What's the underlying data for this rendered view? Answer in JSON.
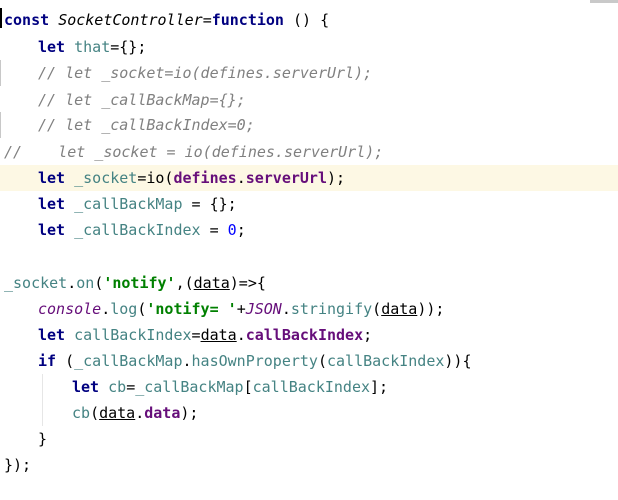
{
  "editor": {
    "lines": [
      {
        "tokens": [
          [
            "kw",
            "const "
          ],
          [
            "cls",
            "SocketController"
          ],
          [
            "plain",
            "="
          ],
          [
            "kw",
            "function"
          ],
          [
            "plain",
            " () {"
          ]
        ]
      },
      {
        "tokens": [
          [
            "kw",
            "let "
          ],
          [
            "var",
            "that"
          ],
          [
            "plain",
            "={};"
          ]
        ]
      },
      {
        "tokens": [
          [
            "cm",
            "// let _socket=io(defines.serverUrl);"
          ]
        ]
      },
      {
        "tokens": [
          [
            "cm",
            "// let _callBackMap={};"
          ]
        ]
      },
      {
        "tokens": [
          [
            "cm",
            "// let _callBackIndex=0;"
          ]
        ]
      },
      {
        "tokens": [
          [
            "cm",
            "//    let _socket = io(defines.serverUrl);"
          ]
        ]
      },
      {
        "tokens": [
          [
            "kw",
            "let "
          ],
          [
            "var",
            "_socket"
          ],
          [
            "plain",
            "="
          ],
          [
            "plain",
            "io("
          ],
          [
            "prop",
            "defines"
          ],
          [
            "plain",
            "."
          ],
          [
            "prop",
            "serverUrl"
          ],
          [
            "plain",
            ");"
          ]
        ]
      },
      {
        "tokens": [
          [
            "kw",
            "let "
          ],
          [
            "var",
            "_callBackMap"
          ],
          [
            "plain",
            " = {};"
          ]
        ]
      },
      {
        "tokens": [
          [
            "kw",
            "let "
          ],
          [
            "var",
            "_callBackIndex"
          ],
          [
            "plain",
            " = "
          ],
          [
            "num",
            "0"
          ],
          [
            "plain",
            ";"
          ]
        ]
      },
      {
        "tokens": []
      },
      {
        "tokens": [
          [
            "var",
            "_socket"
          ],
          [
            "plain",
            "."
          ],
          [
            "fn",
            "on"
          ],
          [
            "plain",
            "("
          ],
          [
            "str",
            "'notify'"
          ],
          [
            "plain",
            ",("
          ],
          [
            "param",
            "data"
          ],
          [
            "plain",
            ")=>{"
          ]
        ]
      },
      {
        "tokens": [
          [
            "gl",
            "console"
          ],
          [
            "plain",
            "."
          ],
          [
            "fn",
            "log"
          ],
          [
            "plain",
            "("
          ],
          [
            "str",
            "'notify= '"
          ],
          [
            "plain",
            "+"
          ],
          [
            "gl",
            "JSON"
          ],
          [
            "plain",
            "."
          ],
          [
            "fn",
            "stringify"
          ],
          [
            "plain",
            "("
          ],
          [
            "param",
            "data"
          ],
          [
            "plain",
            "));"
          ]
        ]
      },
      {
        "tokens": [
          [
            "kw",
            "let "
          ],
          [
            "var",
            "callBackIndex"
          ],
          [
            "plain",
            "="
          ],
          [
            "param",
            "data"
          ],
          [
            "plain",
            "."
          ],
          [
            "prop",
            "callBackIndex"
          ],
          [
            "plain",
            ";"
          ]
        ]
      },
      {
        "tokens": [
          [
            "kw",
            "if "
          ],
          [
            "plain",
            "("
          ],
          [
            "var",
            "_callBackMap"
          ],
          [
            "plain",
            "."
          ],
          [
            "fn",
            "hasOwnProperty"
          ],
          [
            "plain",
            "("
          ],
          [
            "var",
            "callBackIndex"
          ],
          [
            "plain",
            "))"
          ],
          [
            "plain",
            "{"
          ]
        ]
      },
      {
        "tokens": [
          [
            "kw",
            "let "
          ],
          [
            "var",
            "cb"
          ],
          [
            "plain",
            "="
          ],
          [
            "var",
            "_callBackMap"
          ],
          [
            "plain",
            "["
          ],
          [
            "var",
            "callBackIndex"
          ],
          [
            "plain",
            "];"
          ]
        ]
      },
      {
        "tokens": [
          [
            "var",
            "cb"
          ],
          [
            "plain",
            "("
          ],
          [
            "param",
            "data"
          ],
          [
            "plain",
            "."
          ],
          [
            "prop",
            "data"
          ],
          [
            "plain",
            ");"
          ]
        ]
      },
      {
        "tokens": [
          [
            "plain",
            "}"
          ]
        ]
      },
      {
        "tokens": [
          [
            "plain",
            "});"
          ]
        ]
      }
    ]
  }
}
